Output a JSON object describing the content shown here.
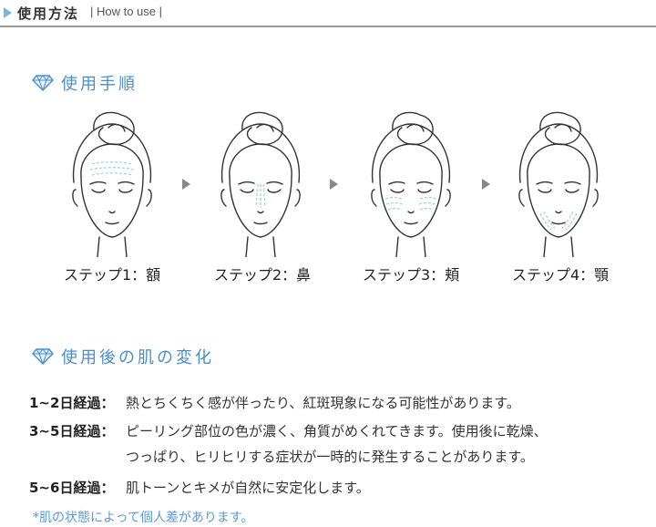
{
  "header": {
    "title": "使用方法",
    "subtitle": "| How to use |"
  },
  "procedure": {
    "heading": "使用手順",
    "icon": "diamond-icon",
    "steps": [
      {
        "label": "ステップ1：額",
        "area": "forehead"
      },
      {
        "label": "ステップ2：鼻",
        "area": "nose"
      },
      {
        "label": "ステップ3：頬",
        "area": "cheeks"
      },
      {
        "label": "ステップ4：顎",
        "area": "chin"
      }
    ],
    "arrow_icon": "arrow-right-icon",
    "accent_color": "#9fd3dc"
  },
  "changes": {
    "heading": "使用後の肌の変化",
    "icon": "diamond-icon",
    "rows": [
      {
        "label": "1~2日経過：",
        "text": [
          "熱とちくちく感が伴ったり、紅斑現象になる可能性があります。"
        ]
      },
      {
        "label": "3~5日経過：",
        "text": [
          "ピーリング部位の色が濃く、角質がめくれてきます。使用後に乾燥、",
          "つっぱり、ヒリヒリする症状が一時的に発生することがあります。"
        ]
      },
      {
        "label": "5~6日経過：",
        "text": [
          "肌トーンとキメが自然に安定化します。"
        ]
      }
    ],
    "note": "*肌の状態によって個人差があります。"
  },
  "colors": {
    "heading_blue": "#4a8ec8",
    "note_blue": "#5a9ad4",
    "header_line": "#9a9a9a"
  }
}
